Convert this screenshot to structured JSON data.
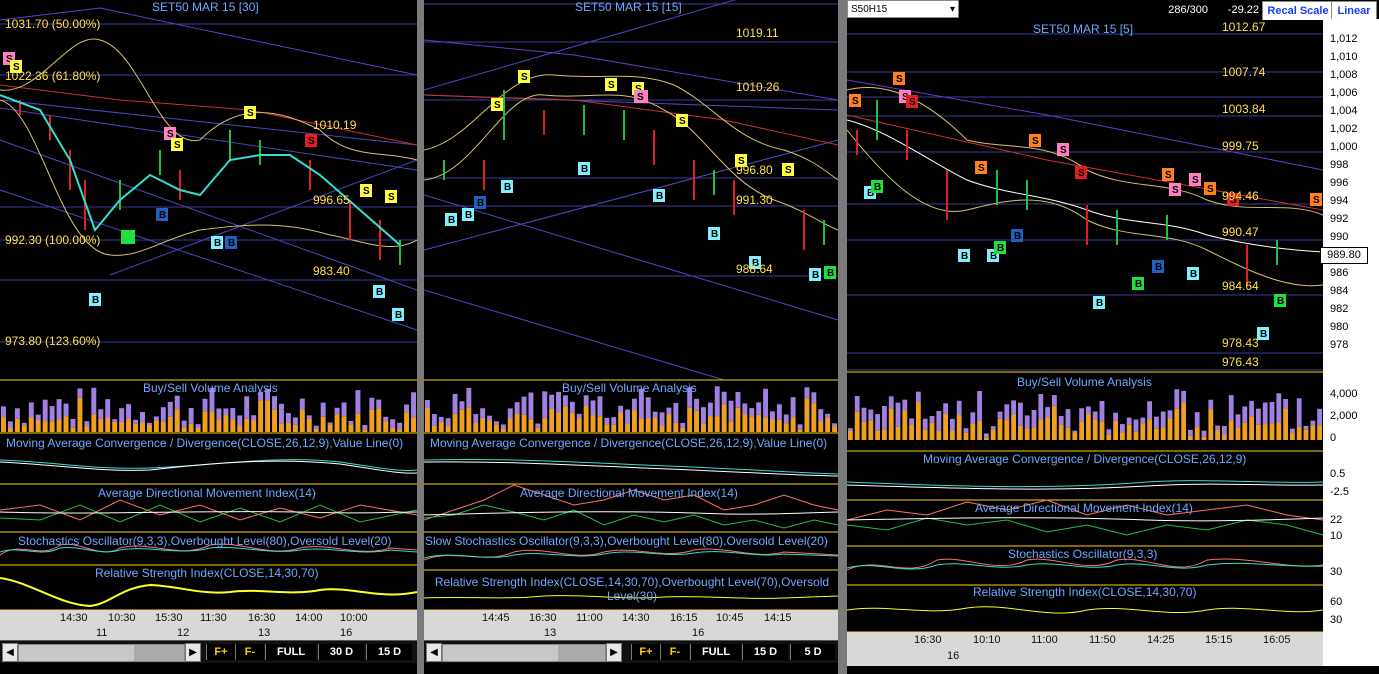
{
  "panes": [
    {
      "title": "SET50 MAR 15   [30]",
      "price_levels": [
        "1031.70 (50.00%)",
        "1022.36 (61.80%)",
        "992.30 (100.00%)",
        "973.80 (123.60%)",
        "1010.19",
        "996.65",
        "983.40"
      ],
      "indicators": [
        "Buy/Sell Volume Analysis",
        "Moving Average Convergence / Divergence(CLOSE,26,12,9),Value Line(0)",
        "Average Directional Movement Index(14)",
        "Stochastics Oscillator(9,3,3),Overbought Level(80),Oversold Level(20)",
        "Relative Strength Index(CLOSE,14,30,70)"
      ],
      "time_labels": [
        "14:30",
        "10:30",
        "15:30",
        "11:30",
        "16:30",
        "14:00",
        "10:00"
      ],
      "date_labels": [
        "11",
        "12",
        "13",
        "16"
      ],
      "toolbar": [
        "F+",
        "F-",
        "FULL",
        "30 D",
        "15 D"
      ]
    },
    {
      "title": "SET50 MAR 15   [15]",
      "price_levels": [
        "1019.11",
        "1010.26",
        "996.80",
        "991.30",
        "988.64"
      ],
      "indicators": [
        "Buy/Sell Volume Analysis",
        "Moving Average Convergence / Divergence(CLOSE,26,12,9),Value Line(0)",
        "Average Directional Movement Index(14)",
        "Slow Stochastics Oscillator(9,3,3),Overbought Level(80),Oversold Level(20)",
        "Relative Strength Index(CLOSE,14,30,70),Overbought Level(70),Oversold Level(30)"
      ],
      "time_labels": [
        "14:45",
        "16:30",
        "11:00",
        "14:30",
        "16:15",
        "10:45",
        "14:15"
      ],
      "date_labels": [
        "13",
        "16"
      ],
      "toolbar": [
        "F+",
        "F-",
        "FULL",
        "15 D",
        "5 D"
      ]
    },
    {
      "title": "SET50 MAR 15   [5]",
      "price_levels": [
        "1012.67",
        "1007.74",
        "1003.84",
        "999.75",
        "994.46",
        "990.47",
        "984.64",
        "978.43",
        "976.43"
      ],
      "indicators": [
        "Buy/Sell Volume Analysis",
        "Moving Average Convergence / Divergence(CLOSE,26,12,9)",
        "Average Directional Movement Index(14)",
        "Stochastics Oscillator(9,3,3)",
        "Relative Strength Index(CLOSE,14,30,70)"
      ],
      "time_labels": [
        "16:30",
        "10:10",
        "11:00",
        "11:50",
        "14:25",
        "15:15",
        "16:05"
      ],
      "date_labels": [
        "16"
      ],
      "right_axis": [
        "1,012",
        "1,010",
        "1,008",
        "1,006",
        "1,004",
        "1,002",
        "1,000",
        "998",
        "996",
        "994",
        "992",
        "990",
        "988",
        "986",
        "984",
        "982",
        "980",
        "978"
      ],
      "volume_axis": [
        "4,000",
        "2,000",
        "0"
      ],
      "macd_axis": [
        "0.5",
        "-2.5"
      ],
      "adx_axis": [
        "22",
        "10"
      ],
      "stoch_axis": [
        "30"
      ],
      "rsi_axis": [
        "60",
        "30"
      ],
      "current_value": "989.80"
    }
  ],
  "header": {
    "symbol": "S50H15",
    "count": "286/300",
    "change": "-29.22",
    "recal_button": "Recal Scale",
    "linear_button": "Linear"
  },
  "chart_data": [
    {
      "type": "line",
      "title": "SET50 MAR 15   [30]",
      "x": [
        "14:30",
        "10:30",
        "15:30",
        "11:30",
        "16:30",
        "14:00",
        "10:00"
      ],
      "series": [
        {
          "values": [
            1005,
            992,
            998,
            1004,
            1002,
            996,
            988
          ]
        }
      ]
    },
    {
      "type": "line",
      "title": "SET50 MAR 15   [15]",
      "x": [
        "14:45",
        "16:30",
        "11:00",
        "14:30",
        "16:15",
        "10:45",
        "14:15"
      ],
      "series": [
        {
          "values": [
            998,
            1006,
            1004,
            1002,
            996,
            994,
            989
          ]
        }
      ]
    },
    {
      "type": "line",
      "title": "SET50 MAR 15   [5]",
      "x": [
        "16:30",
        "10:10",
        "11:00",
        "11:50",
        "14:25",
        "15:15",
        "16:05"
      ],
      "series": [
        {
          "values": [
            1003,
            994,
            997,
            991,
            993,
            989,
            989.8
          ]
        }
      ],
      "ylim": [
        977,
        1013
      ]
    }
  ]
}
